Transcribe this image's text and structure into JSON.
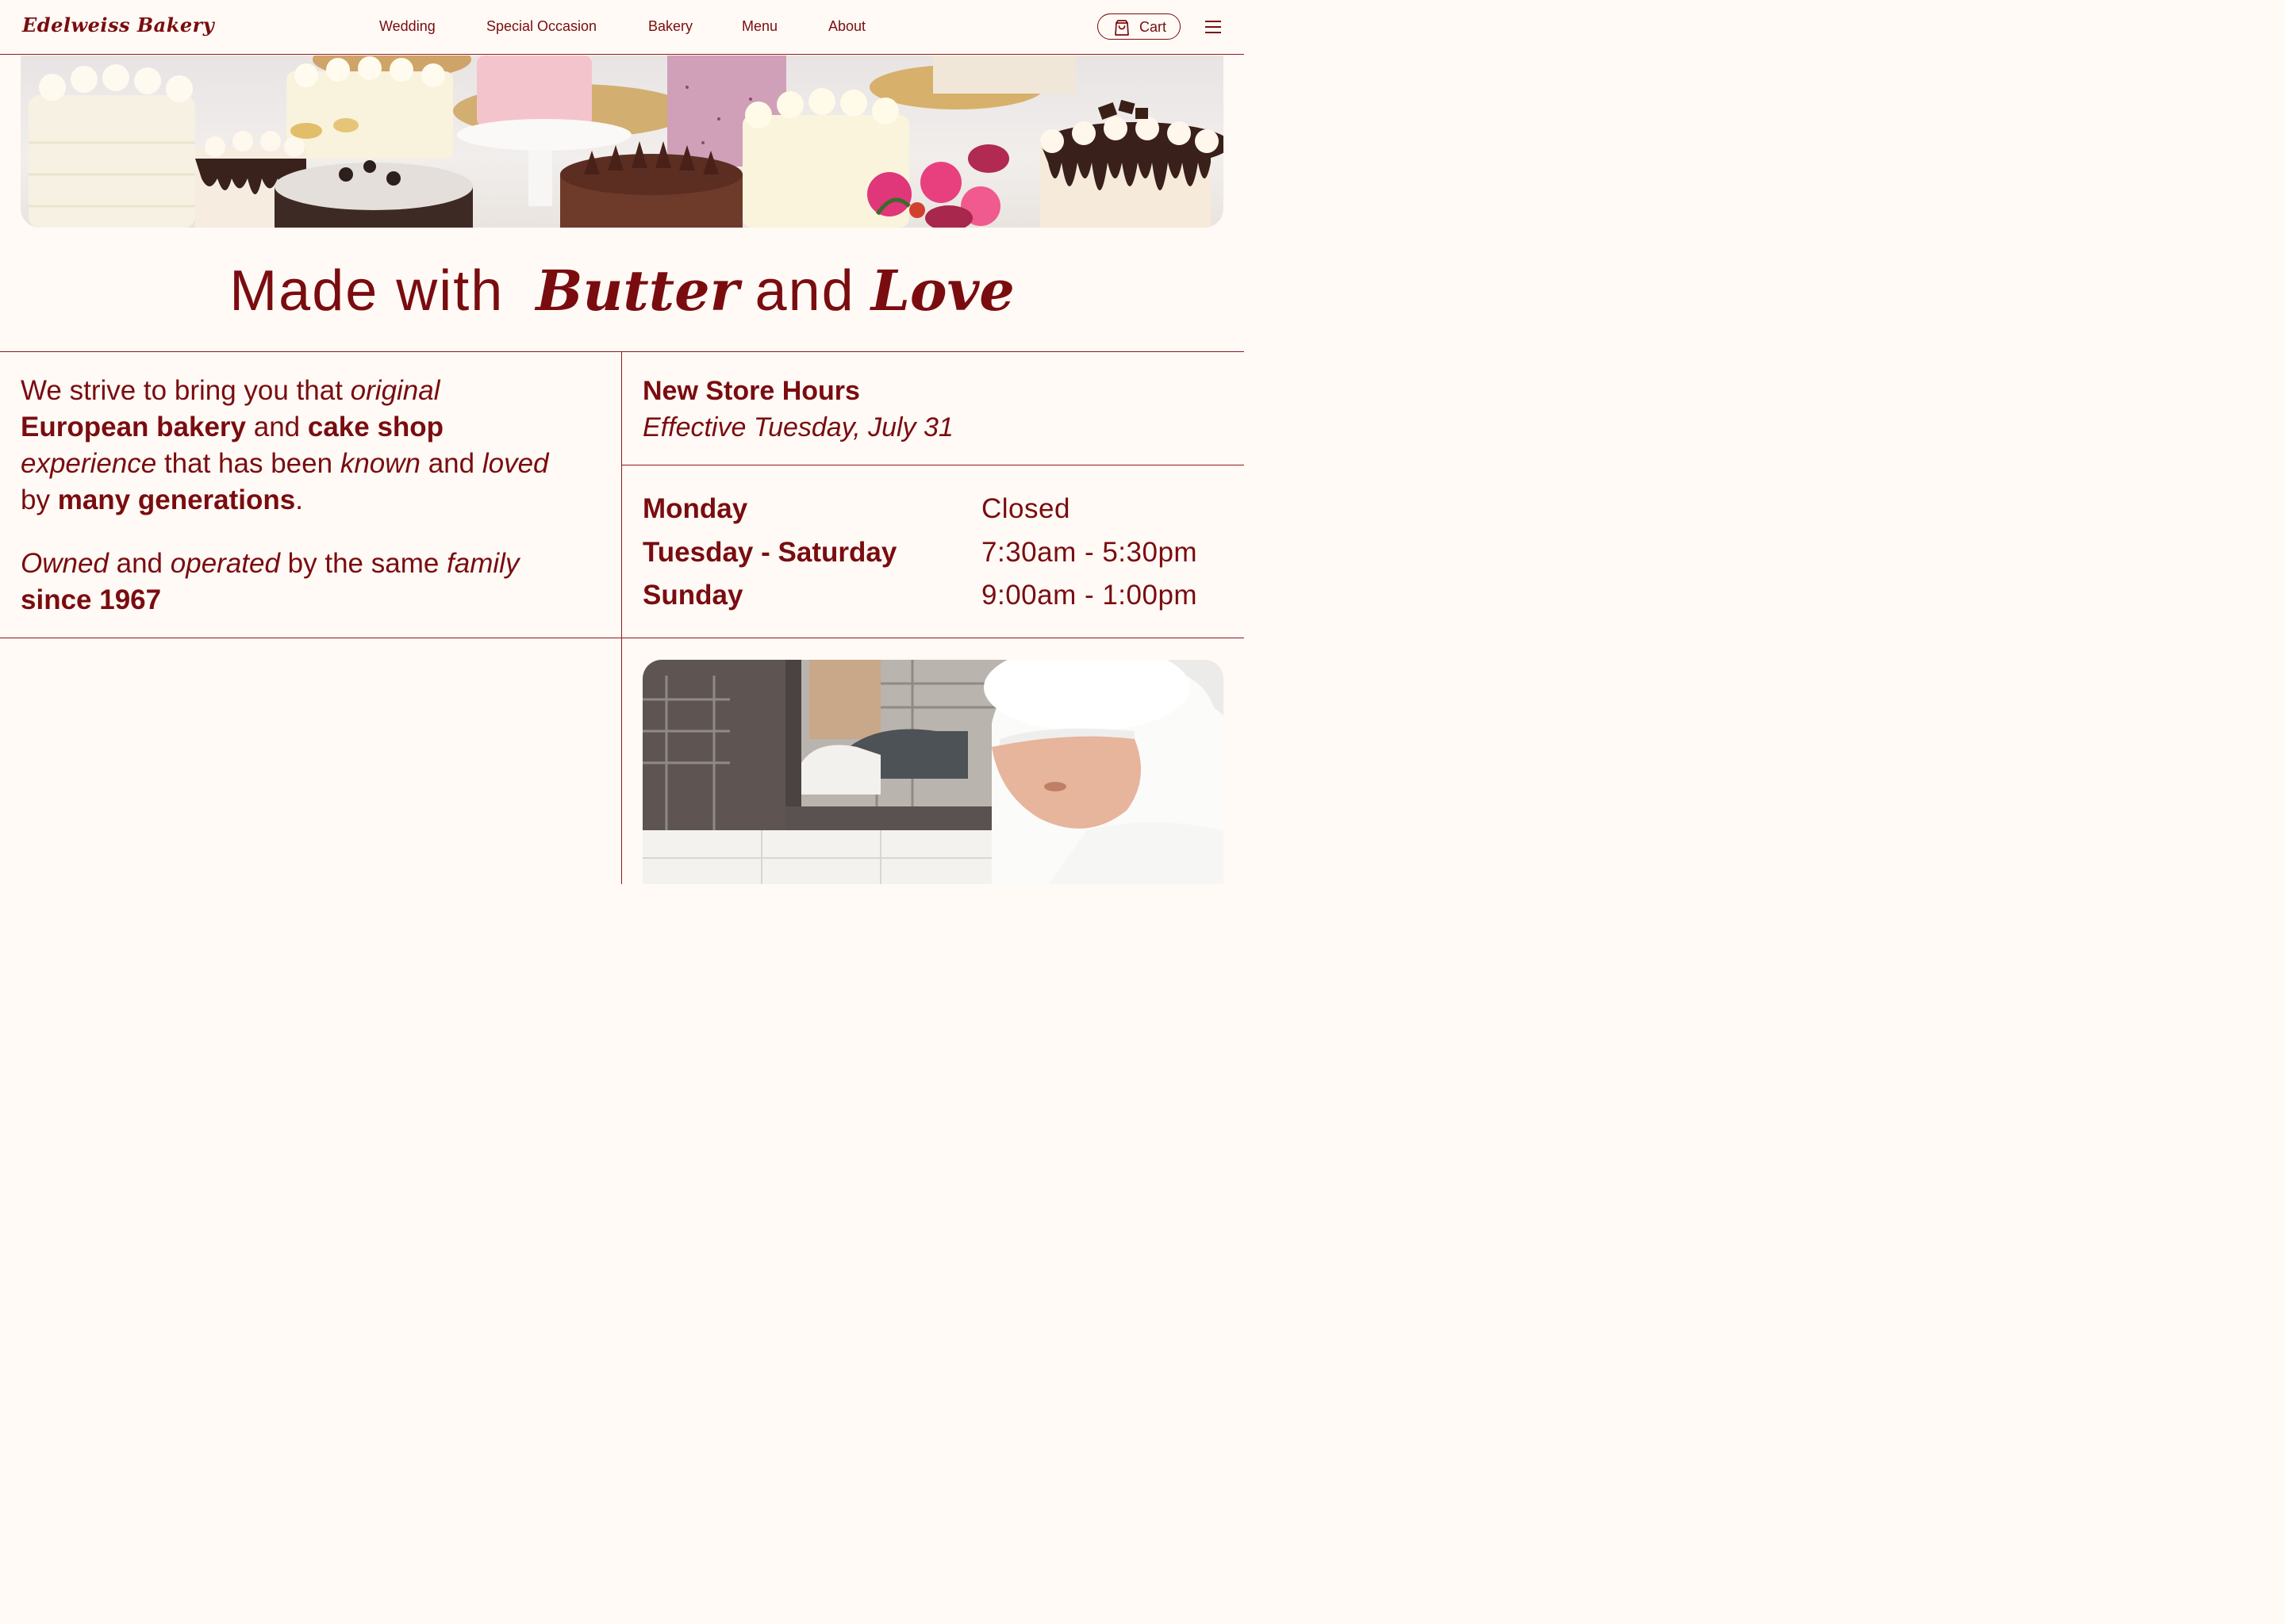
{
  "header": {
    "logo": "Edelweiss Bakery",
    "nav": [
      "Wedding",
      "Special Occasion",
      "Bakery",
      "Menu",
      "About"
    ],
    "cart_label": "Cart",
    "icons": {
      "cart": "shopping-bag-icon",
      "menu": "hamburger-menu-icon"
    }
  },
  "hero": {
    "subject": "assorted-cakes-photo"
  },
  "headline": {
    "part1": "Made with",
    "part2": "Butter",
    "part3": "and",
    "part4": "Love"
  },
  "intro": {
    "p1": [
      "We strive to bring you that ",
      "original",
      "European bakery",
      " and ",
      "cake shop",
      "experience",
      " that has been ",
      "known",
      " and ",
      "loved",
      "by ",
      "many generations",
      "."
    ],
    "p2": [
      "Owned",
      " and ",
      "operated",
      " by the same ",
      "family",
      "since 1967"
    ]
  },
  "hours": {
    "title": "New Store Hours",
    "subtitle": "Effective Tuesday, July 31",
    "rows": [
      {
        "day": "Monday",
        "time": "Closed"
      },
      {
        "day": "Tuesday - Saturday",
        "time": "7:30am - 5:30pm"
      },
      {
        "day": "Sunday",
        "time": "9:00am - 1:00pm"
      }
    ]
  },
  "colors": {
    "brand": "#7a0c10",
    "background": "#fffaf5",
    "rule": "#8f1a1e"
  }
}
